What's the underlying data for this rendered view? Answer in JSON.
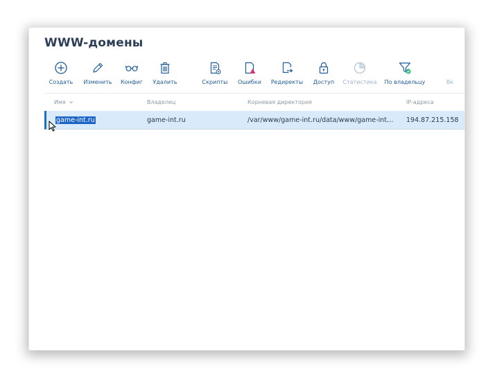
{
  "page": {
    "title": "WWW-домены"
  },
  "toolbar": {
    "create": "Создать",
    "edit": "Изменить",
    "config": "Конфиг",
    "delete": "Удалить",
    "scripts": "Скрипты",
    "errors": "Ошибки",
    "redirects": "Редиректы",
    "access": "Доступ",
    "stats": "Статистика",
    "by_owner": "По владельцу",
    "more": "Вк"
  },
  "table": {
    "columns": {
      "name": "Имя",
      "owner": "Владелец",
      "root": "Корневая директория",
      "ip": "IP-адреса"
    },
    "rows": [
      {
        "name": "game-int.ru",
        "owner": "game-int.ru",
        "root": "/var/www/game-int.ru/data/www/game-int…",
        "ip": "194.87.215.158"
      }
    ]
  },
  "colors": {
    "title": "#2c3e57",
    "toolbar_label": "#1e5b9b",
    "selected_row": "#d9ebfa",
    "selection_highlight": "#1d64c8",
    "row_marker": "#1e6fbf"
  },
  "icons": {
    "create": "plus-circle-icon",
    "edit": "pencil-icon",
    "config": "glasses-icon",
    "delete": "trash-icon",
    "scripts": "script-file-icon",
    "errors": "error-file-icon",
    "redirects": "redirect-file-icon",
    "access": "lock-icon",
    "stats": "pie-chart-icon",
    "by_owner": "filter-check-icon",
    "sort": "chevron-down-icon",
    "cursor": "mouse-pointer-icon"
  }
}
